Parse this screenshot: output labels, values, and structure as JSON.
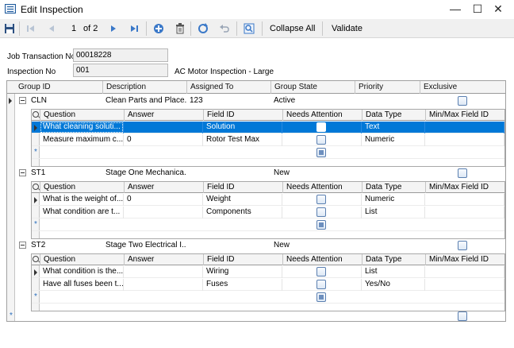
{
  "window": {
    "title": "Edit Inspection",
    "controls": {
      "minimize": "—",
      "maximize": "☐",
      "close": "✕"
    }
  },
  "toolbar": {
    "page_current": "1",
    "page_total": "of 2",
    "collapse_all_label": "Collapse All",
    "validate_label": "Validate",
    "icons": [
      "save-icon",
      "first-record-icon",
      "previous-record-icon",
      "next-record-icon",
      "last-record-icon",
      "add-icon",
      "delete-icon",
      "refresh-icon",
      "undo-icon",
      "find-icon"
    ]
  },
  "header": {
    "job_transaction_label": "Job Transaction No",
    "job_transaction_value": "00018228",
    "inspection_label": "Inspection No",
    "inspection_value": "001",
    "inspection_description": "AC Motor Inspection - Large"
  },
  "grid": {
    "columns": [
      "Group ID",
      "Description",
      "Assigned To",
      "Group State",
      "Priority",
      "Exclusive"
    ],
    "child_columns": [
      "Question",
      "Answer",
      "Field ID",
      "Needs Attention",
      "Data Type",
      "Min/Max Field ID"
    ],
    "groups": [
      {
        "group_id": "CLN",
        "description": "Clean Parts and Place...",
        "assigned_to": "123",
        "group_state": "Active",
        "priority": "",
        "questions": [
          {
            "question": "What cleaning soluti...",
            "answer": "",
            "field_id": "Solution",
            "data_type": "Text",
            "minmax": ""
          },
          {
            "question": "Measure maximum c...",
            "answer": "0",
            "field_id": "Rotor Test Max",
            "data_type": "Numeric",
            "minmax": ""
          }
        ]
      },
      {
        "group_id": "ST1",
        "description": "Stage One Mechanica...",
        "assigned_to": "",
        "group_state": "New",
        "priority": "",
        "questions": [
          {
            "question": "What is the weight of...",
            "answer": "0",
            "field_id": "Weight",
            "data_type": "Numeric",
            "minmax": ""
          },
          {
            "question": "What condition are t...",
            "answer": "",
            "field_id": "Components",
            "data_type": "List",
            "minmax": ""
          }
        ]
      },
      {
        "group_id": "ST2",
        "description": "Stage Two Electrical I...",
        "assigned_to": "",
        "group_state": "New",
        "priority": "",
        "questions": [
          {
            "question": "What condition is the...",
            "answer": "",
            "field_id": "Wiring",
            "data_type": "List",
            "minmax": ""
          },
          {
            "question": "Have all fuses been t...",
            "answer": "",
            "field_id": "Fuses",
            "data_type": "Yes/No",
            "minmax": ""
          }
        ]
      }
    ],
    "new_row_symbol": "*"
  },
  "colors": {
    "selection": "#0078d7",
    "toolbar_bg": "#f0f0f0",
    "accent": "#2a6ebd"
  }
}
